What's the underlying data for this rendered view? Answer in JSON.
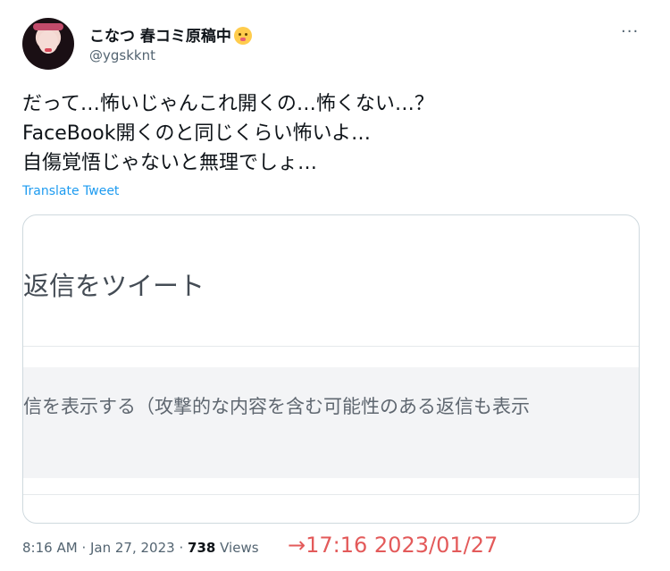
{
  "user": {
    "display_name": "こなつ 春コミ原稿中",
    "emoji_icon": "kissing-face-emoji",
    "handle": "@ygskknt"
  },
  "tweet": {
    "lines": [
      "だって…怖いじゃんこれ開くの…怖くない…？",
      "FaceBook開くのと同じくらい怖いよ…",
      "自傷覚悟じゃないと無理でしょ…"
    ],
    "translate_label": "Translate Tweet"
  },
  "card": {
    "heading": "返信をツイート",
    "option_text": "信を表示する（攻撃的な内容を含む可能性のある返信も表示"
  },
  "meta": {
    "time": "8:16 AM",
    "date": "Jan 27, 2023",
    "separator": "·",
    "views_count": "738",
    "views_label": "Views"
  },
  "annotation": {
    "text": "→17:16  2023/01/27",
    "color": "#e35a5a"
  },
  "colors": {
    "link": "#1d9bf0",
    "secondary_text": "#536471"
  }
}
